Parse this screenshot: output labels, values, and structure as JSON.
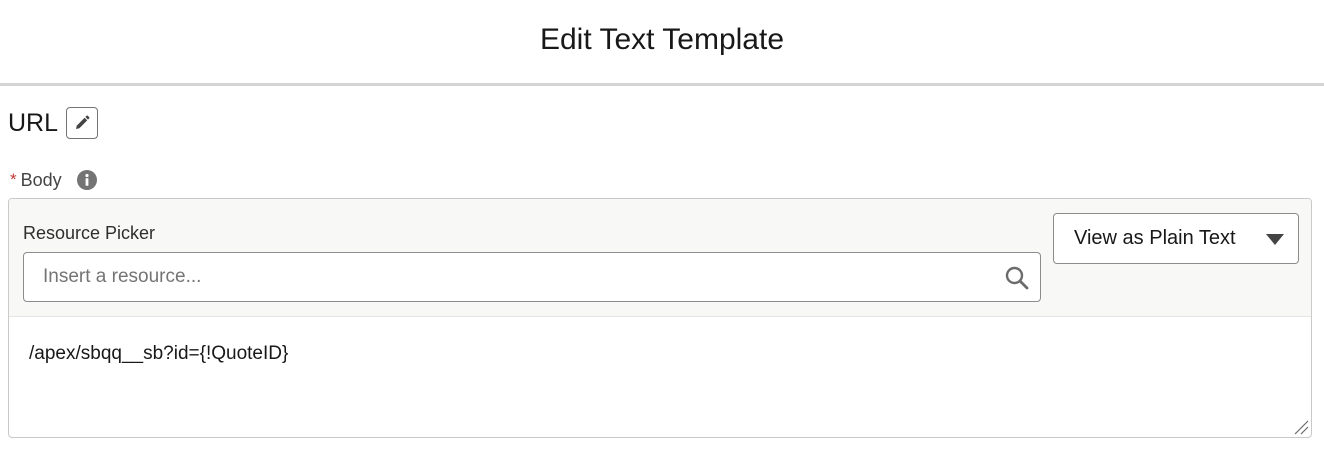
{
  "modal": {
    "title": "Edit Text Template"
  },
  "template": {
    "name": "URL"
  },
  "body_field": {
    "required_marker": "*",
    "label": "Body",
    "resource_picker": {
      "label": "Resource Picker",
      "placeholder": "Insert a resource..."
    },
    "view_mode": {
      "selected": "View as Plain Text"
    },
    "content": "/apex/sbqq__sb?id={!QuoteID}"
  }
}
